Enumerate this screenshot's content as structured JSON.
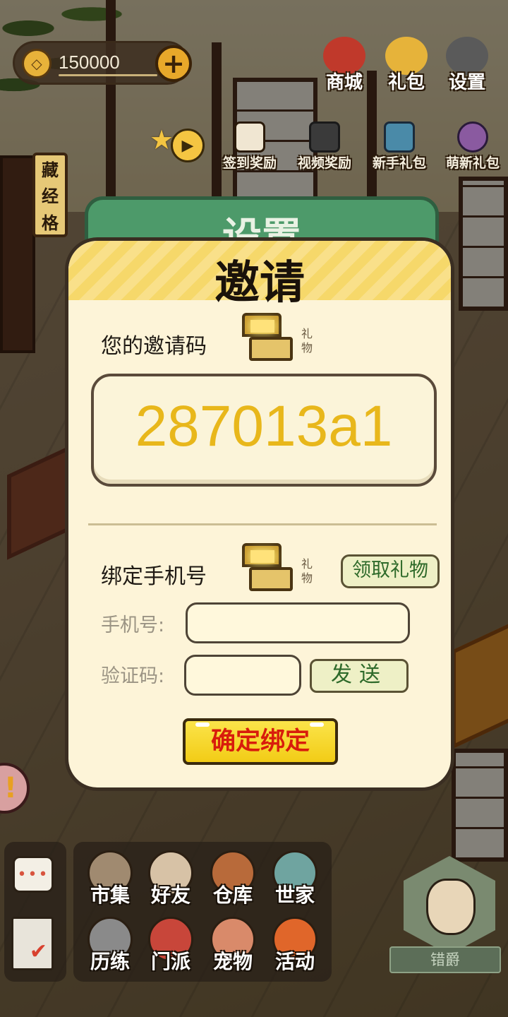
{
  "hud": {
    "coins": "150000",
    "add_symbol": "+",
    "coin_symbol": "◇",
    "vertical_sign": [
      "藏",
      "经",
      "格"
    ]
  },
  "top_buttons": [
    {
      "label": "商城",
      "icon": "shop-bag-icon",
      "color": "#c0392b"
    },
    {
      "label": "礼包",
      "icon": "gift-gold-icon",
      "color": "#e6b33a"
    },
    {
      "label": "设置",
      "icon": "gear-icon",
      "color": "#5a5a5a"
    }
  ],
  "sub_buttons": [
    {
      "label": "签到奖励",
      "icon": "calendar-icon",
      "color": "#f0e6d2"
    },
    {
      "label": "视频奖励",
      "icon": "clapperboard-icon",
      "color": "#3a3a3a"
    },
    {
      "label": "新手礼包",
      "icon": "treasure-chest-icon",
      "color": "#4a8aa8"
    },
    {
      "label": "萌新礼包",
      "icon": "character-gift-icon",
      "color": "#8a5aa0"
    }
  ],
  "settings_panel": {
    "title": "设置"
  },
  "invite_dialog": {
    "title": "邀请",
    "invite_code_label": "您的邀请码",
    "gift_label": "礼物",
    "invite_code": "287013a1",
    "bind_phone_label": "绑定手机号",
    "claim_gift_button": "领取礼物",
    "phone_label": "手机号:",
    "phone_value": "",
    "verify_label": "验证码:",
    "verify_value": "",
    "send_button": "发送",
    "confirm_button": "确定绑定"
  },
  "bottom_dock": {
    "chat_icon": "•••",
    "items": [
      {
        "label": "市集",
        "icon": "market-icon",
        "color": "#a08a70"
      },
      {
        "label": "好友",
        "icon": "handshake-icon",
        "color": "#d7c2a6"
      },
      {
        "label": "仓库",
        "icon": "chest-icon",
        "color": "#b86a3a"
      },
      {
        "label": "世家",
        "icon": "house-icon",
        "color": "#6fa4a0"
      },
      {
        "label": "历练",
        "icon": "swords-icon",
        "color": "#8a8a8a"
      },
      {
        "label": "门派",
        "icon": "banner-icon",
        "color": "#c8463a"
      },
      {
        "label": "宠物",
        "icon": "paw-icon",
        "color": "#d98a6a"
      },
      {
        "label": "活动",
        "icon": "lantern-icon",
        "color": "#e0662a"
      }
    ],
    "rank_label": "错爵",
    "alert_symbol": "!"
  }
}
